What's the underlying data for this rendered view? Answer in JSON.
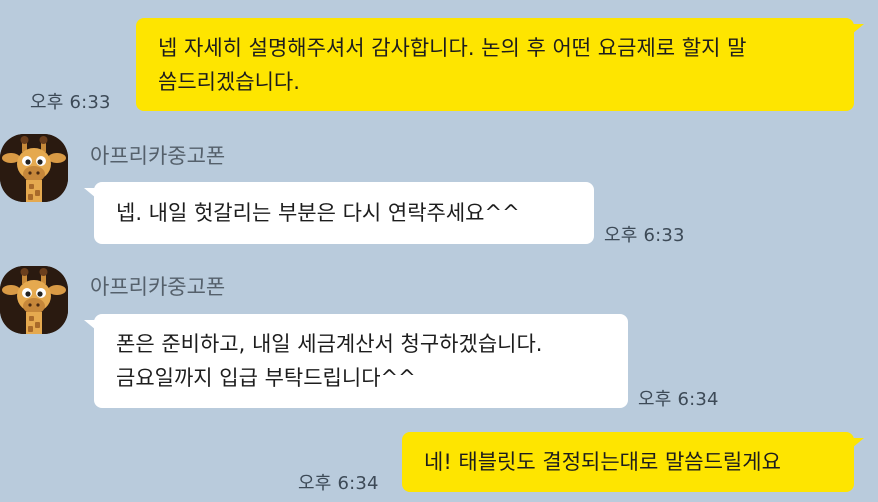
{
  "messages": [
    {
      "direction": "outgoing",
      "lines": [
        "넵 자세히 설명해주셔서 감사합니다. 논의 후 어떤 요금제로 할지 말",
        "씀드리겠습니다."
      ],
      "time": "오후 6:33"
    },
    {
      "direction": "incoming",
      "sender": "아프리카중고폰",
      "avatar_icon": "giraffe-icon",
      "lines": [
        "넵. 내일 헛갈리는 부분은 다시 연락주세요^^"
      ],
      "time": "오후 6:33"
    },
    {
      "direction": "incoming",
      "sender": "아프리카중고폰",
      "avatar_icon": "giraffe-icon",
      "lines": [
        "폰은 준비하고, 내일 세금계산서 청구하겠습니다.",
        "금요일까지 입급 부탁드립니다^^"
      ],
      "time": "오후 6:34"
    },
    {
      "direction": "outgoing",
      "lines": [
        "네! 태블릿도 결정되는대로 말씀드릴게요"
      ],
      "time": "오후 6:34"
    }
  ],
  "colors": {
    "background": "#b9cbdc",
    "outgoing_bubble": "#fee500",
    "incoming_bubble": "#ffffff",
    "timestamp": "#3d4a57",
    "sender_name": "#55606b"
  }
}
